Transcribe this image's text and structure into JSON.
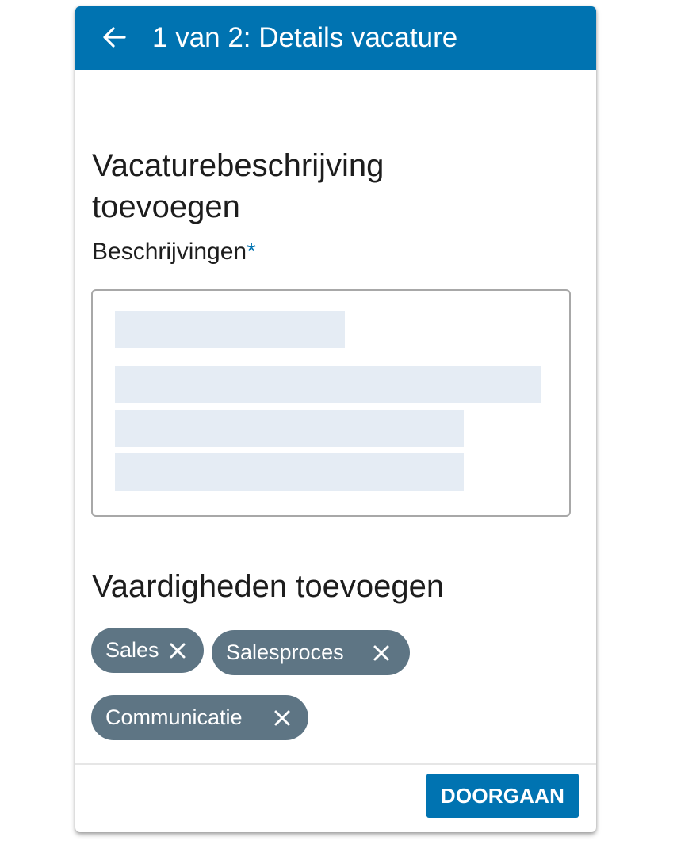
{
  "header": {
    "title": "1 van 2: Details vacature",
    "back_icon": "arrow-left-icon",
    "background_color": "#0073b1"
  },
  "description_section": {
    "title": "Vacaturebeschrijving toevoegen",
    "field_label": "Beschrijvingen",
    "required_marker": "*",
    "content_state": "loading-placeholder"
  },
  "skills_section": {
    "title": "Vaardigheden toevoegen",
    "skills": [
      {
        "label": "Sales",
        "remove_icon": "close-icon"
      },
      {
        "label": "Salesproces",
        "remove_icon": "close-icon"
      },
      {
        "label": "Communicatie",
        "remove_icon": "close-icon"
      }
    ],
    "chip_color": "#5e7584"
  },
  "footer": {
    "continue_label": "DOORGAAN",
    "button_color": "#0073b1"
  }
}
